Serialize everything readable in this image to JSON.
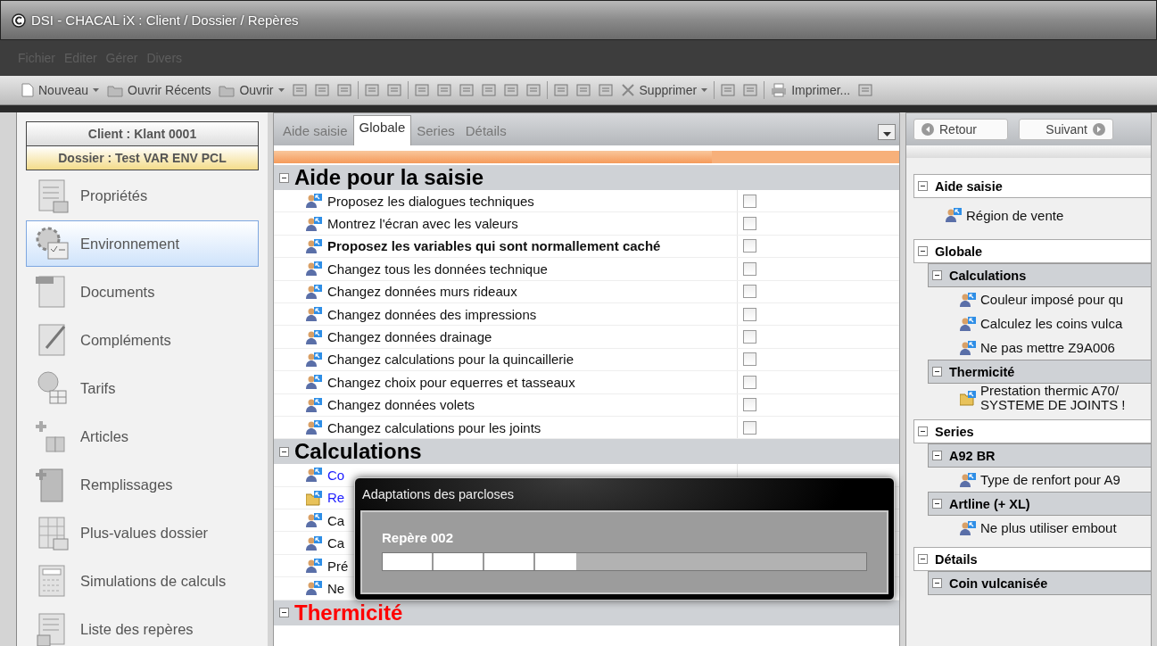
{
  "window": {
    "title": "DSI - CHACAL iX : Client / Dossier / Repères"
  },
  "menu": [
    {
      "label": "Fichier",
      "disabled": true
    },
    {
      "label": "Editer",
      "disabled": true
    },
    {
      "label": "Gérer",
      "disabled": true
    },
    {
      "label": "Divers",
      "disabled": true
    }
  ],
  "toolbar": [
    {
      "kind": "new",
      "label": "Nouveau",
      "dropdown": true
    },
    {
      "kind": "recent",
      "label": "Ouvrir Récents",
      "dropdown": false
    },
    {
      "kind": "open",
      "label": "Ouvrir",
      "dropdown": true
    },
    {
      "kind": "tool"
    },
    {
      "kind": "tool"
    },
    {
      "kind": "tool"
    },
    {
      "kind": "separator"
    },
    {
      "kind": "tool"
    },
    {
      "kind": "tool"
    },
    {
      "kind": "separator"
    },
    {
      "kind": "tool"
    },
    {
      "kind": "tool"
    },
    {
      "kind": "tool"
    },
    {
      "kind": "tool"
    },
    {
      "kind": "tool"
    },
    {
      "kind": "tool"
    },
    {
      "kind": "separator"
    },
    {
      "kind": "tool"
    },
    {
      "kind": "tool"
    },
    {
      "kind": "tool"
    },
    {
      "kind": "delete",
      "label": "Supprimer",
      "dropdown": true
    },
    {
      "kind": "separator"
    },
    {
      "kind": "tool"
    },
    {
      "kind": "tool"
    },
    {
      "kind": "separator"
    },
    {
      "kind": "print",
      "label": "Imprimer...",
      "dropdown": false
    },
    {
      "kind": "tool"
    }
  ],
  "sidebar": {
    "client": "Client : Klant 0001",
    "dossier": "Dossier : Test VAR ENV PCL",
    "items": [
      {
        "kind": "page",
        "label": "Propriétés",
        "selected": false
      },
      {
        "kind": "gear",
        "label": "Environnement",
        "selected": true
      },
      {
        "kind": "pdf",
        "label": "Documents",
        "selected": false
      },
      {
        "kind": "pen",
        "label": "Compléments",
        "selected": false
      },
      {
        "kind": "coin",
        "label": "Tarifs",
        "selected": false
      },
      {
        "kind": "boxes",
        "label": "Articles",
        "selected": false
      },
      {
        "kind": "book",
        "label": "Remplissages",
        "selected": false
      },
      {
        "kind": "table",
        "label": "Plus-values dossier",
        "selected": false
      },
      {
        "kind": "calculator",
        "label": "Simulations de calculs",
        "selected": false
      },
      {
        "kind": "list",
        "label": "Liste des repères",
        "selected": false
      }
    ]
  },
  "tabs": [
    {
      "label": "Aide saisie",
      "selected": false
    },
    {
      "label": "Globale",
      "selected": true
    },
    {
      "label": "Series",
      "selected": false
    },
    {
      "label": "Détails",
      "selected": false
    }
  ],
  "sections": [
    {
      "title": "Aide pour la saisie",
      "color": "#000000",
      "expanded": true,
      "rows": [
        {
          "kind": "user",
          "text": "Proposez les dialogues techniques",
          "bold": false,
          "checked": false
        },
        {
          "kind": "user",
          "text": "Montrez l'écran avec les valeurs",
          "bold": false,
          "checked": false
        },
        {
          "kind": "user",
          "text": "Proposez les variables qui sont normallement caché",
          "bold": true,
          "checked": false
        },
        {
          "kind": "user",
          "text": "Changez tous les données technique",
          "bold": false,
          "checked": false
        },
        {
          "kind": "user",
          "text": "Changez données murs rideaux",
          "bold": false,
          "checked": false
        },
        {
          "kind": "user",
          "text": "Changez données des impressions",
          "bold": false,
          "checked": false
        },
        {
          "kind": "user",
          "text": "Changez données drainage",
          "bold": false,
          "checked": false
        },
        {
          "kind": "user",
          "text": "Changez calculations pour la quincaillerie",
          "bold": false,
          "checked": false
        },
        {
          "kind": "user",
          "text": "Changez choix pour equerres et tasseaux",
          "bold": false,
          "checked": false
        },
        {
          "kind": "user",
          "text": "Changez données volets",
          "bold": false,
          "checked": false
        },
        {
          "kind": "user",
          "text": "Changez calculations pour les joints",
          "bold": false,
          "checked": false
        }
      ]
    },
    {
      "title": "Calculations",
      "color": "#000000",
      "expanded": true,
      "rows": [
        {
          "kind": "user",
          "text": "Co",
          "link": true
        },
        {
          "kind": "folder",
          "text": "Re",
          "link": true
        },
        {
          "kind": "user",
          "text": "Ca",
          "link": false
        },
        {
          "kind": "user",
          "text": "Ca",
          "link": false
        },
        {
          "kind": "user",
          "text": "Pré",
          "link": false
        },
        {
          "kind": "user",
          "text": "Ne",
          "link": false
        }
      ]
    },
    {
      "title": "Thermicité",
      "color": "#ff0000",
      "expanded": true
    }
  ],
  "dialog": {
    "title": "Adaptations des parcloses",
    "message": "Repère 002",
    "level": 0.4
  },
  "nav": {
    "back": "Retour",
    "next": "Suivant"
  },
  "tree": [
    {
      "label": "Aide saisie",
      "expanded": true,
      "items": [
        {
          "kind": "user",
          "text": "Région de vente"
        }
      ]
    },
    {
      "label": "Globale",
      "expanded": true,
      "groups": [
        {
          "label": "Calculations",
          "expanded": true,
          "items": [
            {
              "kind": "user",
              "text": "Couleur imposé pour qu"
            },
            {
              "kind": "user",
              "text": "Calculez les coins vulca"
            },
            {
              "kind": "user",
              "text": "Ne pas mettre Z9A006"
            }
          ]
        },
        {
          "label": "Thermicité",
          "expanded": true,
          "items": [
            {
              "kind": "folder",
              "text": "Prestation thermic A70/",
              "text2": "SYSTEME DE JOINTS !"
            }
          ]
        }
      ]
    },
    {
      "label": "Series",
      "expanded": true,
      "groups": [
        {
          "label": "A92 BR",
          "expanded": true,
          "items": [
            {
              "kind": "user",
              "text": "Type de renfort pour A9"
            }
          ]
        },
        {
          "label": "Artline (+ XL)",
          "expanded": true,
          "items": [
            {
              "kind": "user",
              "text": "Ne plus utiliser embout"
            }
          ]
        }
      ]
    },
    {
      "label": "Détails",
      "expanded": true,
      "groups": [
        {
          "label": "Coin vulcanisée",
          "expanded": true
        }
      ]
    }
  ]
}
